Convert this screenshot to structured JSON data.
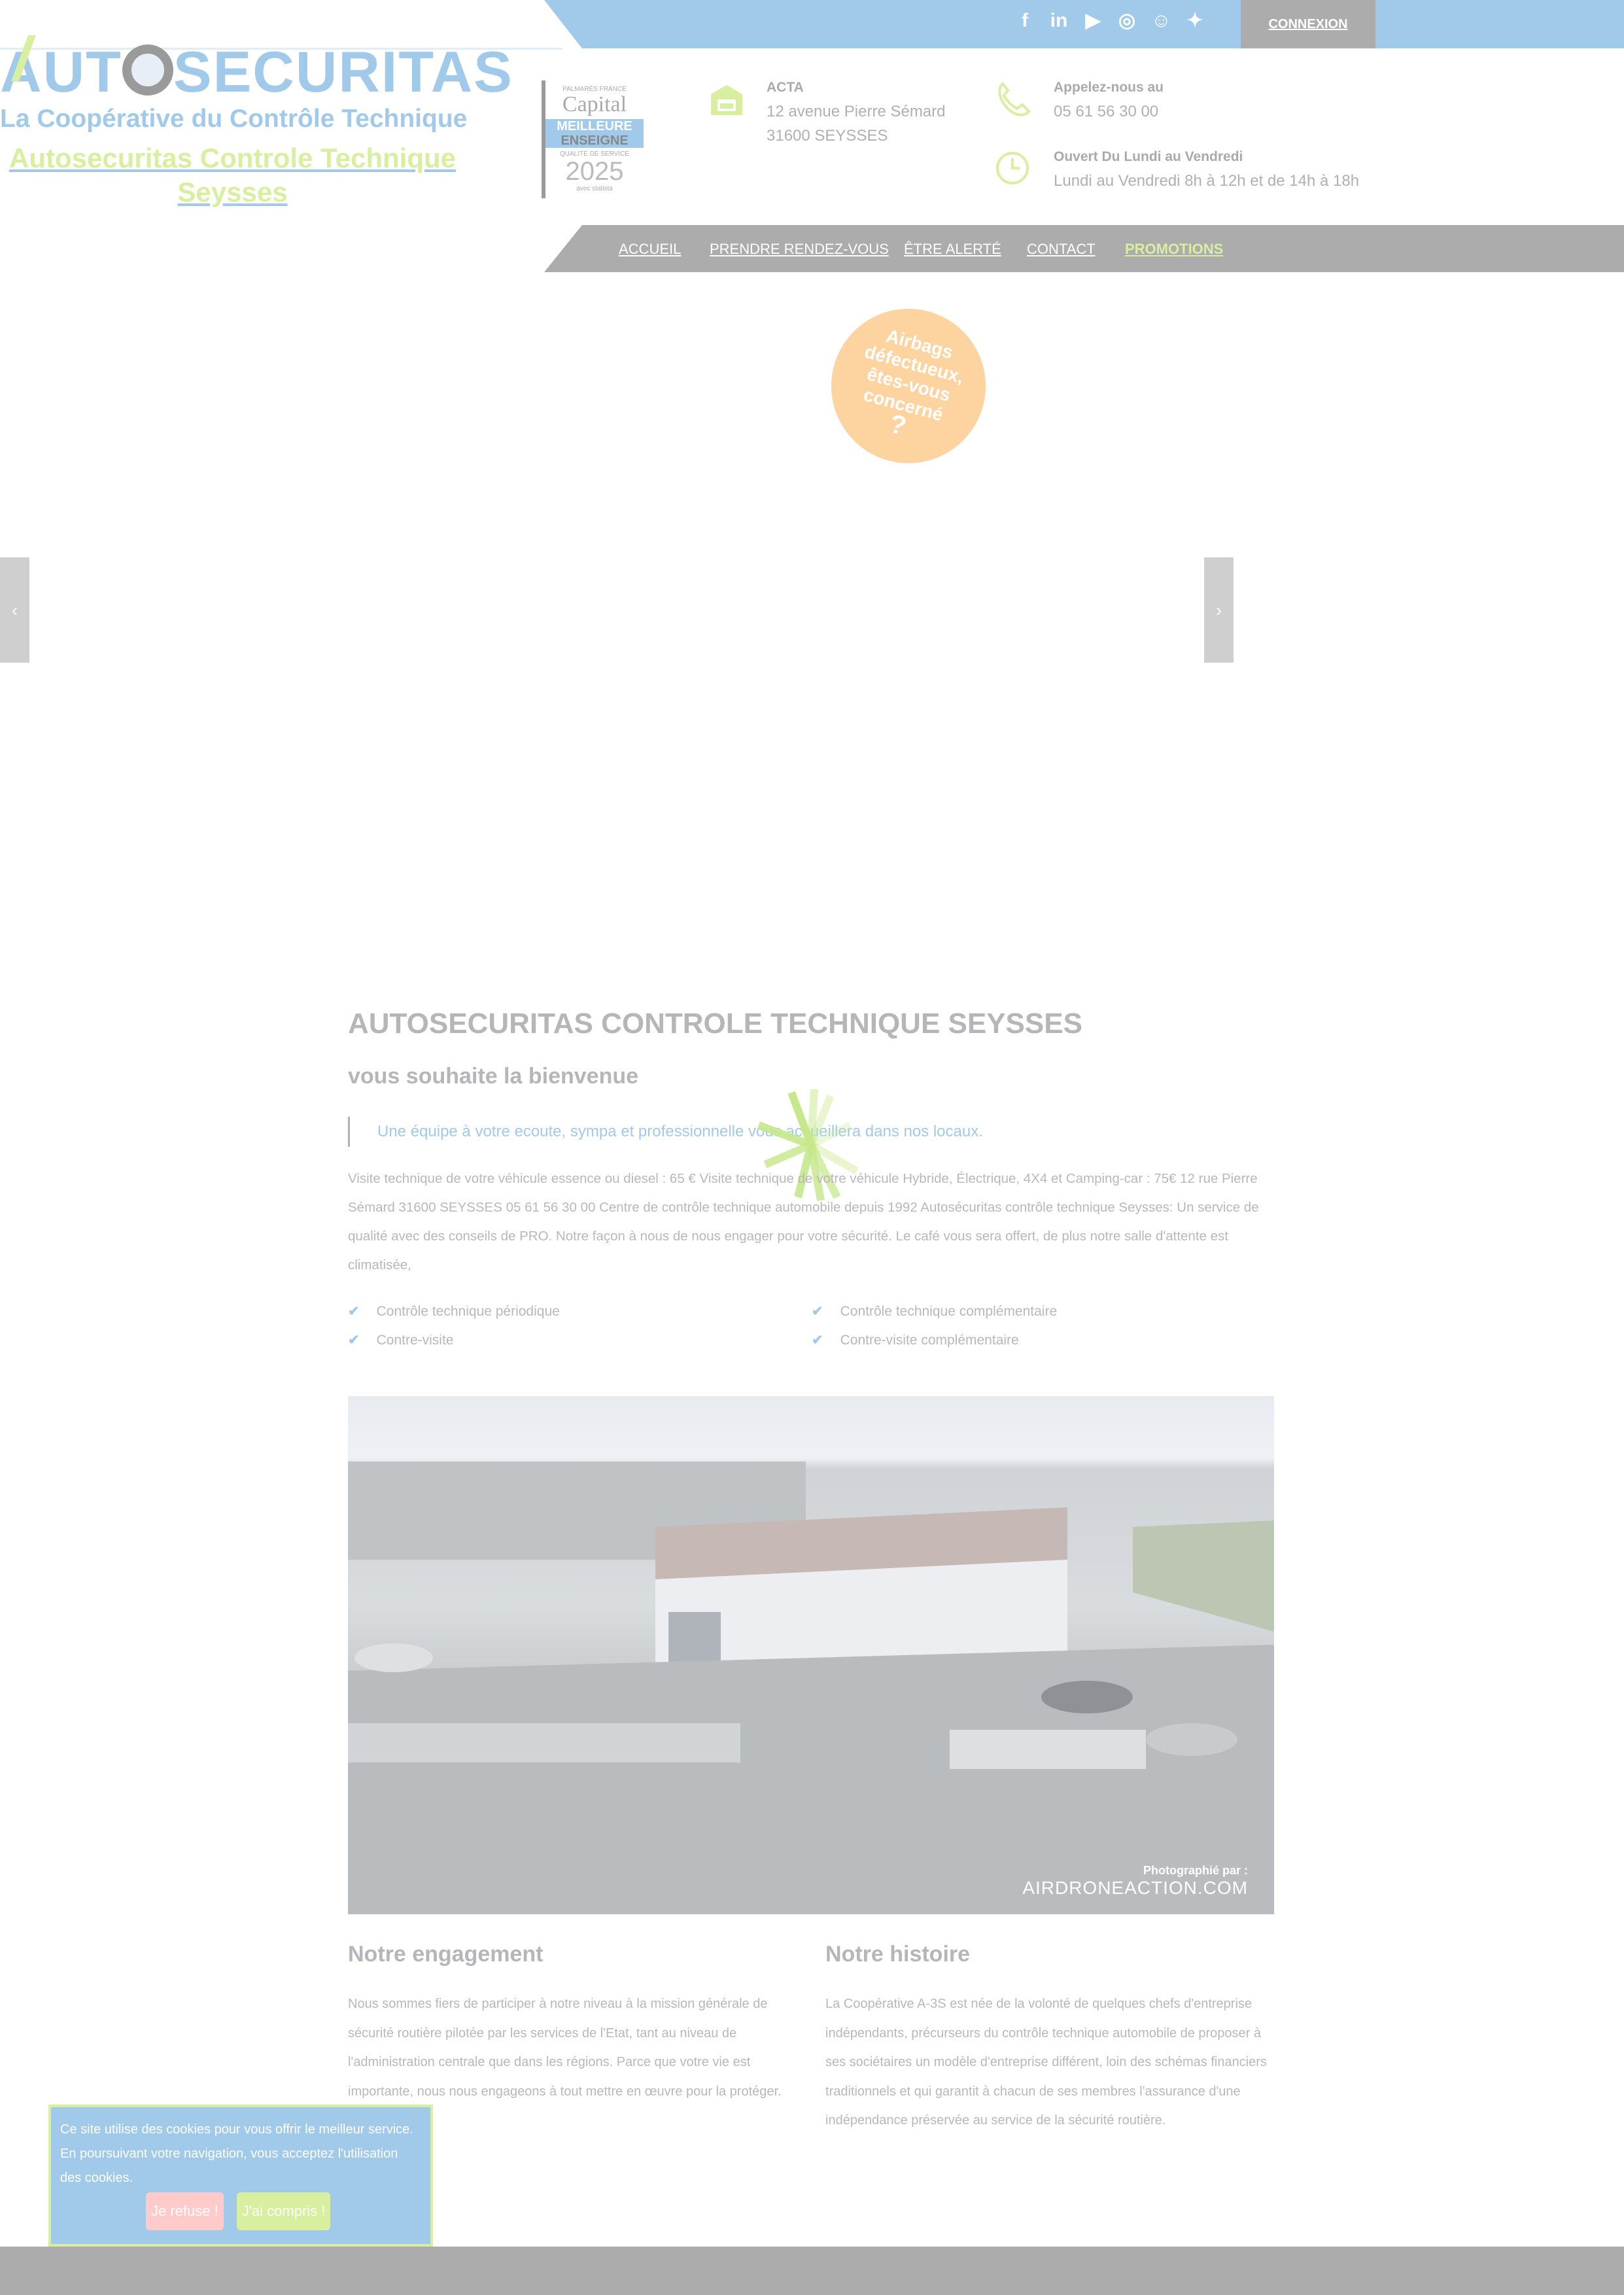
{
  "topbar": {
    "social_icons": [
      "facebook-icon",
      "linkedin-icon",
      "youtube-icon",
      "instagram-icon",
      "snapchat-icon",
      "twitter-icon"
    ],
    "connexion": "CONNEXION"
  },
  "logo": {
    "text": "AUTOSECURITAS",
    "tagline": "La Coopérative du Contrôle Technique"
  },
  "site_name": "Autosecuritas Controle Technique Seysses",
  "badge": {
    "line1": "PALMARÈS FRANCE",
    "brand": "Capital",
    "award1": "MEILLEURE",
    "award2": "ENSEIGNE",
    "line3": "QUALITÉ DE SERVICE",
    "year": "2025",
    "partner": "avec statista"
  },
  "contact": {
    "address": {
      "title": "ACTA",
      "line1": "12 avenue Pierre Sémard",
      "line2": "31600 SEYSSES"
    },
    "phone": {
      "title": "Appelez-nous au",
      "number": "05 61 56 30 00"
    },
    "hours": {
      "title": "Ouvert Du Lundi au Vendredi",
      "text": "Lundi au Vendredi 8h à 12h et de 14h à 18h"
    }
  },
  "nav": [
    "ACCUEIL",
    "PRENDRE RENDEZ-VOUS",
    "ÊTRE ALERTÉ",
    "CONTACT",
    "PROMOTIONS"
  ],
  "promo_bubble": {
    "l1": "Airbags",
    "l2": "défectueux,",
    "l3": "êtes-vous",
    "l4": "concerné",
    "l5": "?"
  },
  "slider": {
    "prev": "‹",
    "next": "›"
  },
  "main": {
    "title": "AUTOSECURITAS CONTROLE TECHNIQUE SEYSSES",
    "subtitle": "vous souhaite la bienvenue",
    "quote": "Une équipe à votre ecoute, sympa et professionnelle vous accueillera dans nos locaux.",
    "paragraph": "  Visite technique de votre véhicule essence ou diesel : 65 €   Visite technique de votre véhicule Hybride, Électrique, 4X4 et Camping-car : 75€     12 rue Pierre Sémard 31600 SEYSSES  05 61 56 30 00 Centre de contrôle technique automobile depuis 1992       Autosécuritas contrôle technique Seysses: Un service de qualité avec des conseils de PRO. Notre façon à nous de nous engager pour votre sécurité.   Le café vous sera offert, de plus notre salle d'attente est climatisée,",
    "checklist": [
      "Contrôle technique périodique",
      "Contre-visite",
      "Contrôle technique complémentaire",
      "Contre-visite complémentaire"
    ],
    "photo_credit": {
      "by": "Photographié par :",
      "site": "AIRDRONEACTION.COM"
    }
  },
  "columns": [
    {
      "title": "Notre engagement",
      "text": "Nous sommes fiers de participer à notre niveau à la mission générale de sécurité routière pilotée par les services de l'Etat, tant au niveau de l'administration centrale que dans les régions. Parce que votre vie est importante, nous nous engageons à tout mettre en œuvre pour la protéger."
    },
    {
      "title": "Notre histoire",
      "text": "La Coopérative A-3S est née de la volonté de quelques chefs d'entreprise indépendants, précurseurs du contrôle technique automobile de proposer à ses sociétaires un modèle d'entreprise différent, loin des schémas financiers traditionnels et qui garantit à chacun de ses membres l'assurance d'une indépendance préservée au service de la sécurité routière."
    }
  ],
  "cookie": {
    "text": "Ce site utilise des cookies pour vous offrir le meilleur service. En poursuivant votre navigation, vous acceptez l'utilisation des cookies.",
    "refuse": "Je refuse !",
    "accept": "J'ai compris !"
  },
  "colors": {
    "blue": "#a0c9ea",
    "green": "#d8efa0",
    "gray": "#acacac",
    "orange": "#fdd3a0",
    "refuse": "#fecaca"
  }
}
